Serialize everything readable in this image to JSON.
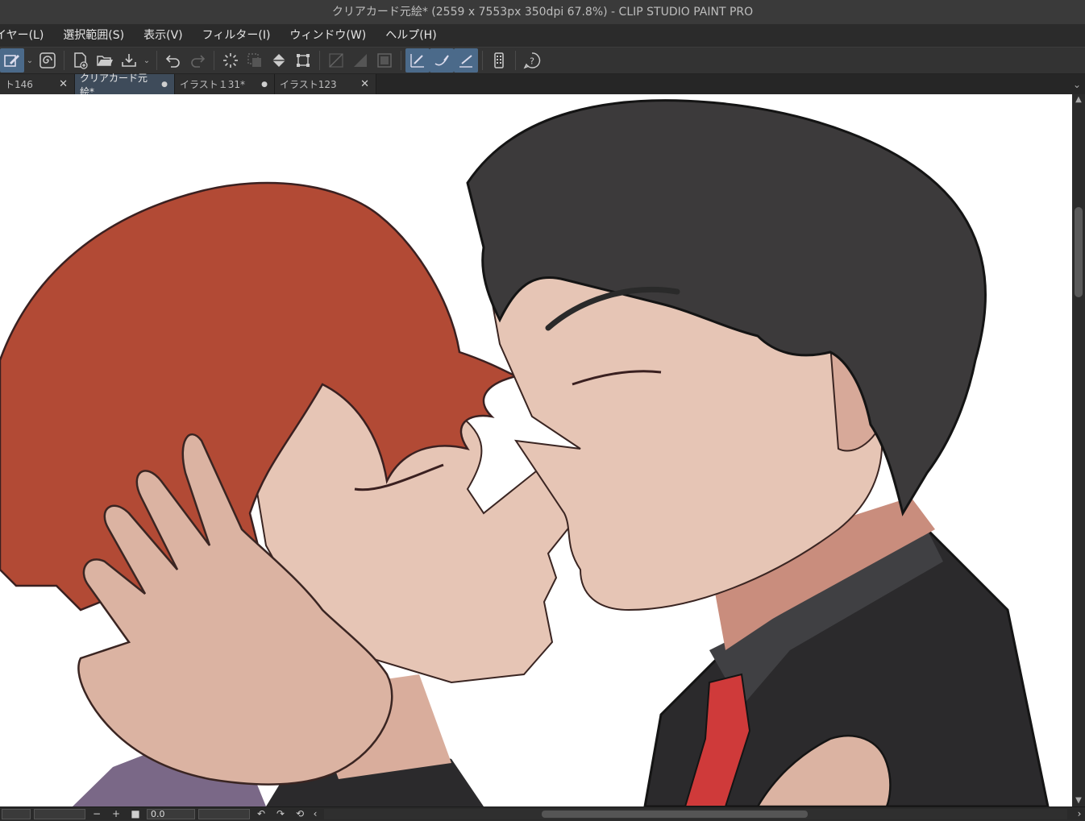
{
  "window": {
    "title": "クリアカード元絵* (2559 x 7553px 350dpi 67.8%)  - CLIP STUDIO PAINT PRO"
  },
  "menu": [
    "イヤー(L)",
    "選択範囲(S)",
    "表示(V)",
    "フィルター(I)",
    "ウィンドウ(W)",
    "ヘルプ(H)"
  ],
  "toolbar": {
    "icons": [
      "edit-layer-icon",
      "dropdown-chevron-icon",
      "spiral-icon",
      "new-file-icon",
      "open-folder-icon",
      "save-icon",
      "dropdown-chevron-icon",
      "undo-icon",
      "redo-icon",
      "loading-icon",
      "select-area-icon",
      "fill-icon",
      "transform-icon",
      "snap-ruler-icon",
      "snap-special-ruler-icon",
      "snap-grid-icon",
      "snap-pen-icon",
      "snap-curve-icon",
      "snap-line-icon",
      "smartphone-icon",
      "help-icon"
    ],
    "accent": "#4b6a8a"
  },
  "tabs": [
    {
      "label": "ト146",
      "mark": "✕"
    },
    {
      "label": "クリアカード元絵*",
      "mark": "●"
    },
    {
      "label": "イラスト１31*",
      "mark": "●"
    },
    {
      "label": "イラスト123",
      "mark": "✕"
    }
  ],
  "status": {
    "zoom": "0.0",
    "minus": "−",
    "plus": "+",
    "stop": "■"
  },
  "colors": {
    "hair_orange": "#b24a35",
    "hair_dark": "#3c3a3b",
    "skin": "#e6c5b5",
    "suit": "#2b2a2c",
    "tie": "#cf3a3a",
    "purple_shirt": "#7a6887"
  }
}
